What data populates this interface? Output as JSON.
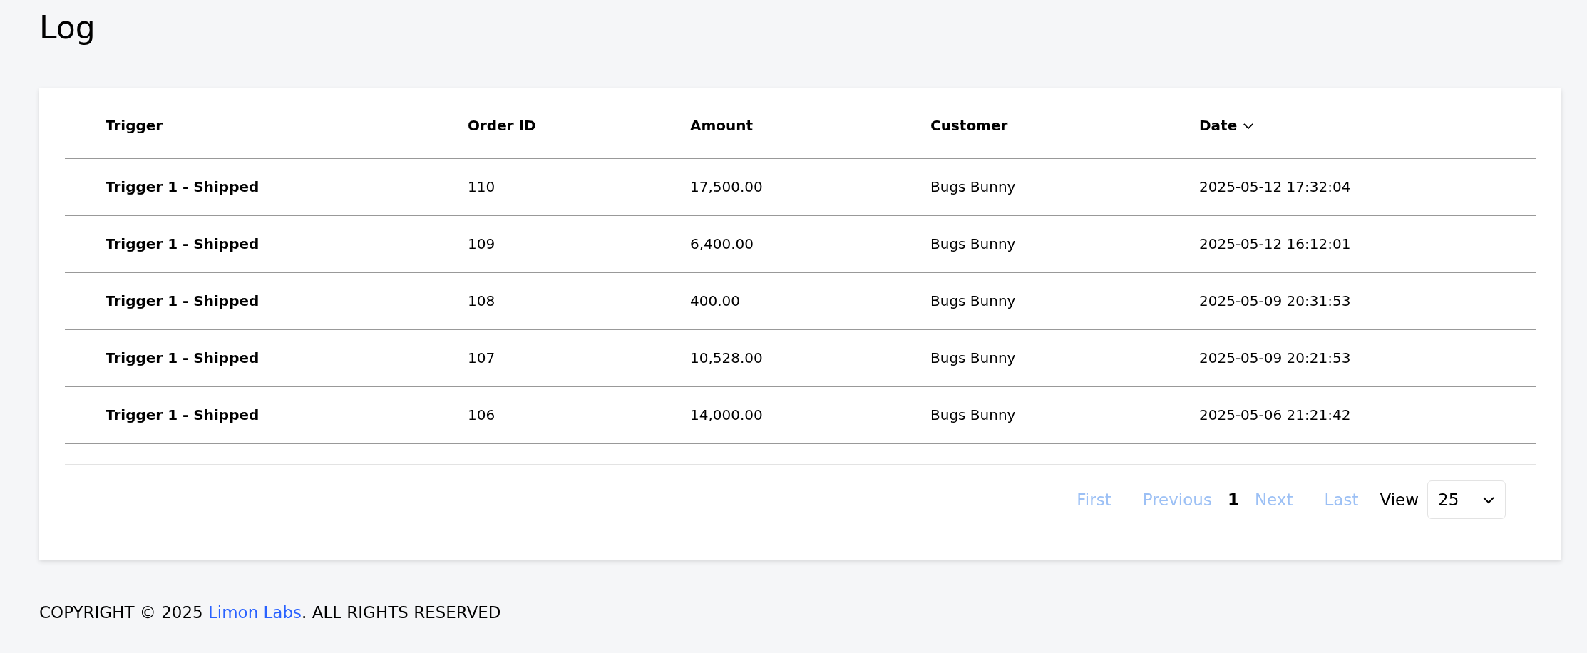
{
  "page_title": "Log",
  "table": {
    "columns": [
      {
        "label": "Trigger",
        "sorted": false
      },
      {
        "label": "Order ID",
        "sorted": false
      },
      {
        "label": "Amount",
        "sorted": false
      },
      {
        "label": "Customer",
        "sorted": false
      },
      {
        "label": "Date",
        "sorted": true
      }
    ],
    "rows": [
      [
        "Trigger 1 - Shipped",
        "110",
        "17,500.00",
        "Bugs Bunny",
        "2025-05-12 17:32:04"
      ],
      [
        "Trigger 1 - Shipped",
        "109",
        "6,400.00",
        "Bugs Bunny",
        "2025-05-12 16:12:01"
      ],
      [
        "Trigger 1 - Shipped",
        "108",
        "400.00",
        "Bugs Bunny",
        "2025-05-09 20:31:53"
      ],
      [
        "Trigger 1 - Shipped",
        "107",
        "10,528.00",
        "Bugs Bunny",
        "2025-05-09 20:21:53"
      ],
      [
        "Trigger 1 - Shipped",
        "106",
        "14,000.00",
        "Bugs Bunny",
        "2025-05-06 21:21:42"
      ]
    ]
  },
  "pagination": {
    "items": [
      {
        "label": "First",
        "kind": "link",
        "disabled": true
      },
      {
        "label": "Previous",
        "kind": "link",
        "disabled": true
      },
      {
        "label": "1",
        "kind": "page",
        "selected": true
      },
      {
        "label": "Next",
        "kind": "link",
        "disabled": true
      },
      {
        "label": "Last",
        "kind": "link",
        "disabled": true
      }
    ],
    "view_label": "View",
    "page_size": "25"
  },
  "footer": {
    "before": "COPYRIGHT © 2025",
    "link": "Limon Labs",
    "after": ". ALL RIGHTS RESERVED"
  }
}
